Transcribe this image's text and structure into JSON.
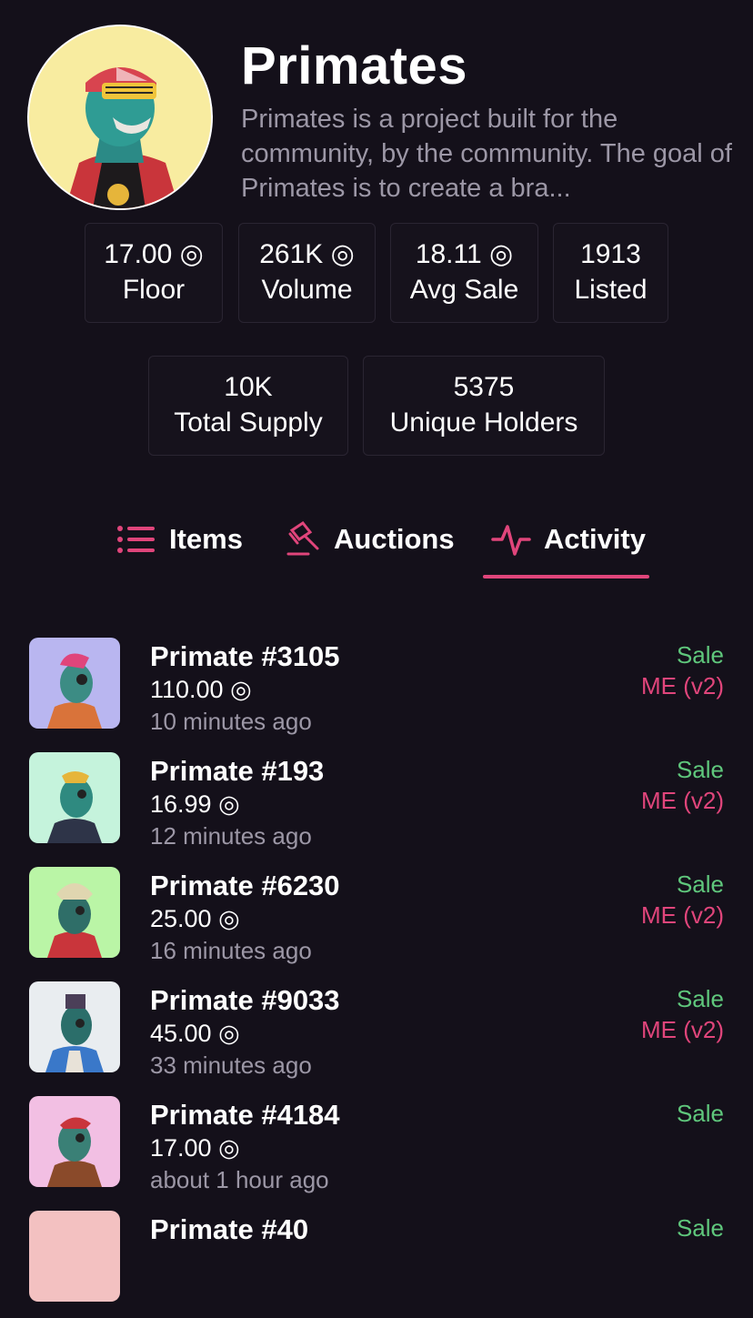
{
  "collection": {
    "name": "Primates",
    "description": "Primates is a project built for the community, by the community. The goal of Primates is to create a bra..."
  },
  "stats": [
    {
      "value": "17.00 ◎",
      "label": "Floor"
    },
    {
      "value": "261K ◎",
      "label": "Volume"
    },
    {
      "value": "18.11 ◎",
      "label": "Avg Sale"
    },
    {
      "value": "1913",
      "label": "Listed"
    },
    {
      "value": "10K",
      "label": "Total Supply"
    },
    {
      "value": "5375",
      "label": "Unique Holders"
    }
  ],
  "tabs": [
    {
      "label": "Items",
      "icon": "list-icon",
      "active": false
    },
    {
      "label": "Auctions",
      "icon": "gavel-icon",
      "active": false
    },
    {
      "label": "Activity",
      "icon": "activity-pulse-icon",
      "active": true
    }
  ],
  "colors": {
    "accent": "#e0457b",
    "sale": "#5fc77c",
    "background": "#14101a",
    "muted": "#9c97a6"
  },
  "activity": [
    {
      "name": "Primate #3105",
      "price": "110.00 ◎",
      "time": "10 minutes ago",
      "type": "Sale",
      "market": "ME (v2)",
      "bg": "#b9b6f0"
    },
    {
      "name": "Primate #193",
      "price": "16.99 ◎",
      "time": "12 minutes ago",
      "type": "Sale",
      "market": "ME (v2)",
      "bg": "#c5f3dc"
    },
    {
      "name": "Primate #6230",
      "price": "25.00 ◎",
      "time": "16 minutes ago",
      "type": "Sale",
      "market": "ME (v2)",
      "bg": "#baf5a6"
    },
    {
      "name": "Primate #9033",
      "price": "45.00 ◎",
      "time": "33 minutes ago",
      "type": "Sale",
      "market": "ME (v2)",
      "bg": "#e9edf0"
    },
    {
      "name": "Primate #4184",
      "price": "17.00 ◎",
      "time": "about 1 hour ago",
      "type": "Sale",
      "market": "",
      "bg": "#f2bfe3"
    },
    {
      "name": "Primate #40",
      "price": "",
      "time": "",
      "type": "Sale",
      "market": "",
      "bg": "#f3c1c1"
    }
  ]
}
